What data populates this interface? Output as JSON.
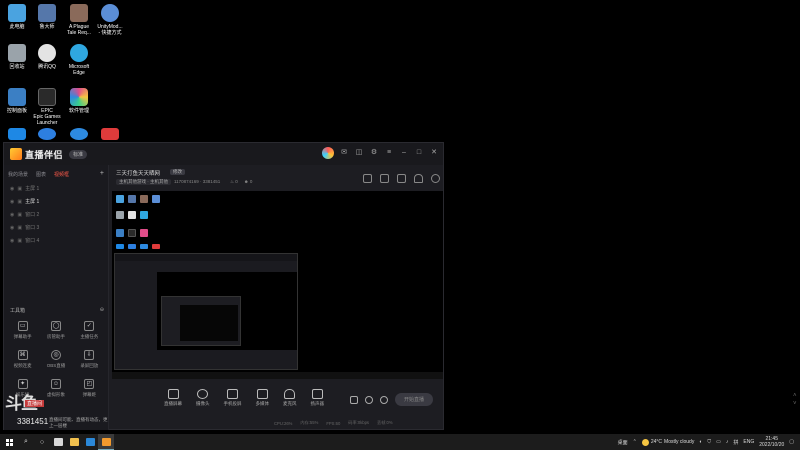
{
  "desktop": {
    "icons": [
      {
        "label": "此电脑",
        "color": "#4aa3e0"
      },
      {
        "label": "鲁大师",
        "color": "#5577aa"
      },
      {
        "label": "A Plague\nTale Req...",
        "color": "#8a6a5a"
      },
      {
        "label": "UnityMod...\n- 快捷方式",
        "color": "#5b8ed6"
      },
      {
        "label": "回收站",
        "color": "#9aa3aa"
      },
      {
        "label": "腾讯QQ",
        "color": "#e3e3e3"
      },
      {
        "label": "Microsoft\nEdge",
        "color": "#2fa7e0"
      },
      {
        "label": "控制面板",
        "color": "#3b7fc4"
      },
      {
        "label": "EPIC\nEpic Games\nLauncher",
        "color": "#2a2a2a"
      },
      {
        "label": "软件管理",
        "color": "#e04d8a"
      },
      {
        "label": "",
        "color": "#1e88e5"
      },
      {
        "label": "",
        "color": "#2d7fe0"
      },
      {
        "label": "",
        "color": "#2d8ae0"
      },
      {
        "label": "",
        "color": "#e03b3b"
      }
    ]
  },
  "app": {
    "brand": "直播伴侣",
    "version": "标准",
    "left_tabs": [
      "我的场景",
      "图表",
      "视频框"
    ],
    "scenes": [
      "主屏 1",
      "主屏 1",
      "窗口 2",
      "窗口 3",
      "窗口 4"
    ],
    "toolbox_title": "工具箱",
    "tools": [
      {
        "label": "弹幕助手",
        "icon": "chat-icon"
      },
      {
        "label": "房管助手",
        "icon": "user-icon"
      },
      {
        "label": "主播任务",
        "icon": "task-icon"
      },
      {
        "label": "视频连麦",
        "icon": "link-icon"
      },
      {
        "label": "OBS直播",
        "icon": "obs-icon"
      },
      {
        "label": "录屏回放",
        "icon": "download-icon"
      },
      {
        "label": "娱乐场",
        "icon": "gamepad-icon"
      },
      {
        "label": "虚拟形象",
        "icon": "avatar-icon"
      },
      {
        "label": "弹幕姬",
        "icon": "danmaku-icon"
      }
    ],
    "stream_title": "三天打鱼天天晒网",
    "edit_label": "修改",
    "category": "主机其他游戏 · 主机其他",
    "room_id": "1170874169 · 3381451",
    "stat_hot": "0",
    "stat_fans": "0",
    "controls": [
      {
        "label": "直播屏幕",
        "icon": "screen-icon"
      },
      {
        "label": "摄像头",
        "icon": "camera-icon"
      },
      {
        "label": "手机投屏",
        "icon": "phone-icon"
      },
      {
        "label": "多媒体",
        "icon": "media-icon"
      },
      {
        "label": "麦克风",
        "icon": "mic-icon"
      },
      {
        "label": "扬声器",
        "icon": "speaker-icon"
      }
    ],
    "start_live": "开始直播",
    "status_items": [
      "CPU:26%",
      "内存:55%",
      "FPS:60",
      "码率:0kbps",
      "丢帧:0%"
    ]
  },
  "promo": {
    "big": "斗鱼",
    "sub": "直播间",
    "id": "3381451",
    "tip": "直播间可能、直播有动态，更上一层楼"
  },
  "taskbar": {
    "search_icon": "search-icon",
    "weather_temp": "24°C",
    "weather_text": "Mostly cloudy",
    "ime": "拼",
    "lang": "ENG",
    "time": "21:45",
    "date": "2022/10/20",
    "tray_label": "桌面"
  }
}
